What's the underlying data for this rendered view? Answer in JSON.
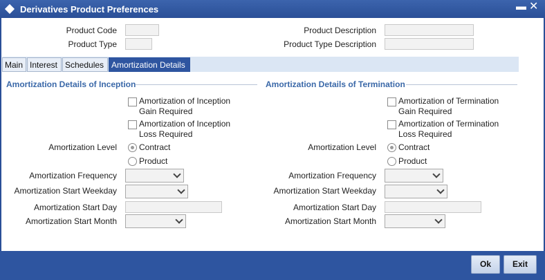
{
  "window": {
    "title": "Derivatives Product Preferences",
    "minimize_glyph": "▬",
    "close_glyph": "✕"
  },
  "header": {
    "product_code_label": "Product Code",
    "product_code_value": "",
    "product_type_label": "Product Type",
    "product_type_value": "",
    "product_description_label": "Product Description",
    "product_description_value": "",
    "product_type_description_label": "Product Type Description",
    "product_type_description_value": ""
  },
  "tabs": [
    {
      "label": "Main",
      "active": false
    },
    {
      "label": "Interest",
      "active": false
    },
    {
      "label": "Schedules",
      "active": false
    },
    {
      "label": "Amortization Details",
      "active": true
    }
  ],
  "inception": {
    "section_title": "Amortization Details of Inception",
    "gain_checkbox_line1": "Amortization of Inception",
    "gain_checkbox_line2": "Gain Required",
    "gain_checked": false,
    "loss_checkbox_line1": "Amortization of Inception",
    "loss_checkbox_line2": "Loss Required",
    "loss_checked": false,
    "level_label": "Amortization Level",
    "level_options": [
      "Contract",
      "Product"
    ],
    "level_selected": "Contract",
    "frequency_label": "Amortization Frequency",
    "frequency_value": "",
    "start_weekday_label": "Amortization Start Weekday",
    "start_weekday_value": "",
    "start_day_label": "Amortization Start Day",
    "start_day_value": "",
    "start_month_label": "Amortization Start Month",
    "start_month_value": ""
  },
  "termination": {
    "section_title": "Amortization Details of Termination",
    "gain_checkbox_line1": "Amortization of Termination",
    "gain_checkbox_line2": "Gain Required",
    "gain_checked": false,
    "loss_checkbox_line1": "Amortization of Termination",
    "loss_checkbox_line2": "Loss Required",
    "loss_checked": false,
    "level_label": "Amortization Level",
    "level_options": [
      "Contract",
      "Product"
    ],
    "level_selected": "Contract",
    "frequency_label": "Amortization Frequency",
    "frequency_value": "",
    "start_weekday_label": "Amortization Start Weekday",
    "start_weekday_value": "",
    "start_day_label": "Amortization Start Day",
    "start_day_value": "",
    "start_month_label": "Amortization Start Month",
    "start_month_value": ""
  },
  "footer": {
    "ok_label": "Ok",
    "exit_label": "Exit"
  },
  "colors": {
    "titlebar": "#2a4f97",
    "accent": "#2e55a0",
    "section_heading": "#3a68a8",
    "tab_strip": "#dbe6f4"
  }
}
